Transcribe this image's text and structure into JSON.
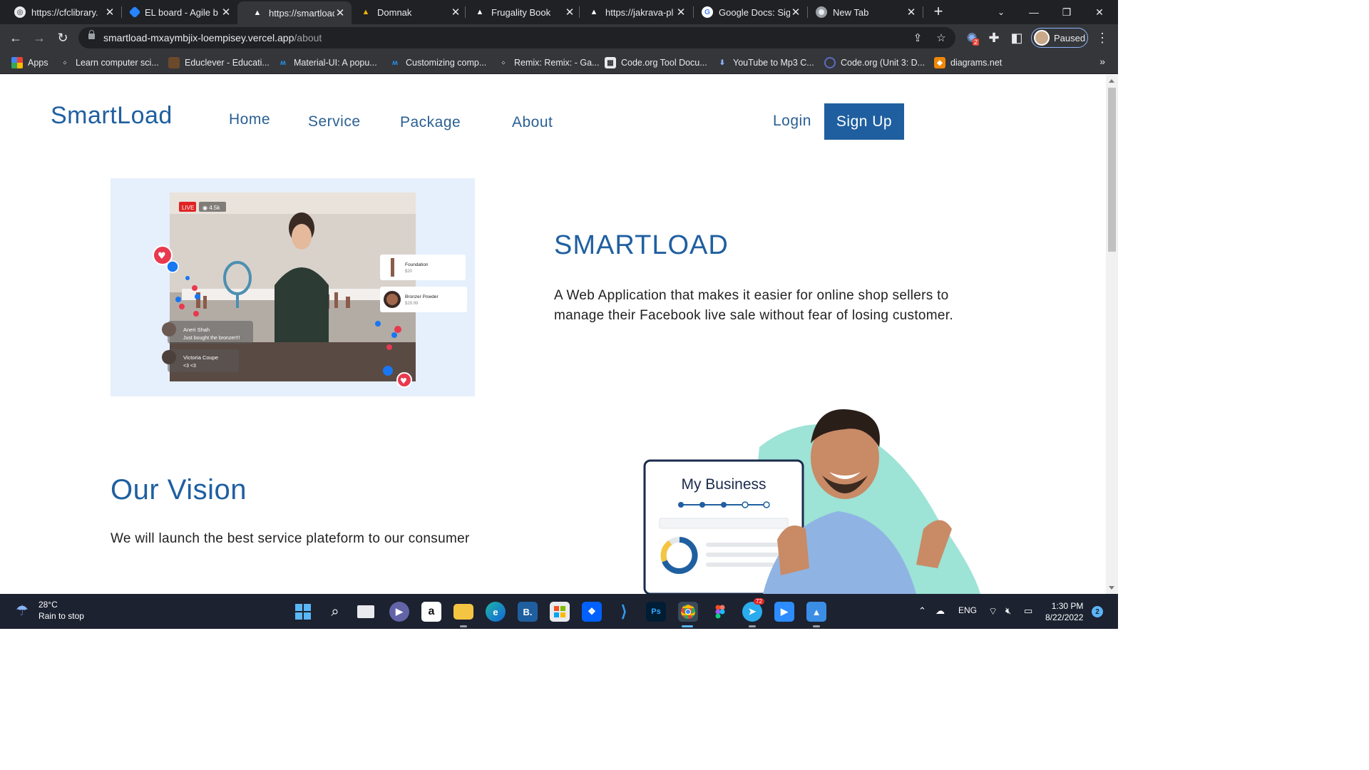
{
  "browser": {
    "tabs": [
      {
        "title": "https://cfclibrary.",
        "icon": "globe-icon"
      },
      {
        "title": "EL board - Agile b",
        "icon": "jira-icon"
      },
      {
        "title": "https://smartload",
        "icon": "vercel-icon",
        "active": true
      },
      {
        "title": "Domnak",
        "icon": "domnak-icon"
      },
      {
        "title": "Frugality Book",
        "icon": "vercel-icon"
      },
      {
        "title": "https://jakrava-pl",
        "icon": "vercel-icon"
      },
      {
        "title": "Google Docs: Sig",
        "icon": "google-icon"
      },
      {
        "title": "New Tab",
        "icon": "chrome-icon"
      }
    ],
    "url_host": "smartload-mxaymbjix-loempisey.vercel.app",
    "url_path": "/about",
    "profile_label": "Paused",
    "extension_badge": "2",
    "bookmarks": [
      {
        "label": "Apps",
        "icon": "apps-grid-icon"
      },
      {
        "label": "Learn computer sci...",
        "icon": "code-org-icon"
      },
      {
        "label": "Educlever - Educati...",
        "icon": "educlever-icon"
      },
      {
        "label": "Material-UI: A popu...",
        "icon": "mui-icon"
      },
      {
        "label": "Customizing comp...",
        "icon": "mui-icon"
      },
      {
        "label": "Remix: Remix: - Ga...",
        "icon": "code-org-icon"
      },
      {
        "label": "Code.org Tool Docu...",
        "icon": "code-org-tool-icon"
      },
      {
        "label": "YouTube to Mp3 C...",
        "icon": "download-icon"
      },
      {
        "label": "Code.org (Unit 3: D...",
        "icon": "code-org-q-icon"
      },
      {
        "label": "diagrams.net",
        "icon": "diagrams-icon"
      }
    ]
  },
  "site": {
    "brand": "SmartLoad",
    "nav": [
      "Home",
      "Service",
      "Package",
      "About"
    ],
    "login": "Login",
    "signup": "Sign Up",
    "hero": {
      "title": "SMARTLOAD",
      "description": "A Web Application that makes it easier for online shop sellers to manage their Facebook live sale without fear of losing customer.",
      "image": {
        "live_badge": "LIVE",
        "viewers": "4.5k",
        "products": [
          {
            "name": "Foundation",
            "price": "$20"
          },
          {
            "name": "Bronzer Powder",
            "price": "$29.99"
          }
        ],
        "comments": [
          {
            "name": "Aneri Shah",
            "text": "Just bought the bronzer!!!"
          },
          {
            "name": "Victoria Coupe",
            "text": "<3 <3"
          }
        ]
      }
    },
    "vision": {
      "title": "Our Vision",
      "description": "We will launch the best service plateform to our consumer"
    },
    "business_card_title": "My Business"
  },
  "taskbar": {
    "weather_temp": "28°C",
    "weather_desc": "Rain to stop",
    "language": "ENG",
    "time": "1:30 PM",
    "date": "8/22/2022",
    "notifications": "2",
    "telegram_badge": "72"
  },
  "colors": {
    "brand_blue": "#1f5fa0",
    "chrome_dark": "#202124",
    "chrome_toolbar": "#35363a",
    "taskbar": "#1c2230"
  }
}
